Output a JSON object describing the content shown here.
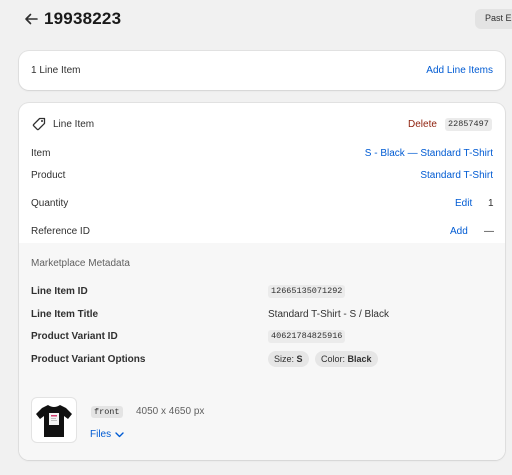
{
  "header": {
    "title": "19938223",
    "past_button_label": "Past E"
  },
  "summary": {
    "count_label": "1 Line Item",
    "add_link": "Add Line Items"
  },
  "line_item": {
    "header_label": "Line Item",
    "delete_label": "Delete",
    "id_badge": "22857497",
    "rows": {
      "item": {
        "label": "Item",
        "value": "S - Black — Standard T-Shirt"
      },
      "product": {
        "label": "Product",
        "value": "Standard T-Shirt"
      },
      "quantity": {
        "label": "Quantity",
        "action": "Edit",
        "value": "1"
      },
      "reference": {
        "label": "Reference ID",
        "action": "Add",
        "value": "—"
      }
    },
    "metadata": {
      "title": "Marketplace Metadata",
      "line_item_id": {
        "label": "Line Item ID",
        "value": "12665135071292"
      },
      "line_item_title": {
        "label": "Line Item Title",
        "value": "Standard T-Shirt - S / Black"
      },
      "product_variant_id": {
        "label": "Product Variant ID",
        "value": "40621784825916"
      },
      "product_variant_options": {
        "label": "Product Variant Options",
        "options": [
          {
            "name": "Size:",
            "value": "S"
          },
          {
            "name": "Color:",
            "value": "Black"
          }
        ]
      }
    },
    "file": {
      "side_badge": "front",
      "dimensions": "4050 x 4650 px",
      "files_link": "Files"
    }
  },
  "colors": {
    "link": "#005bd3",
    "delete": "#8e1f0b",
    "page_bg": "#f1f1f1",
    "card_bg": "#ffffff"
  }
}
